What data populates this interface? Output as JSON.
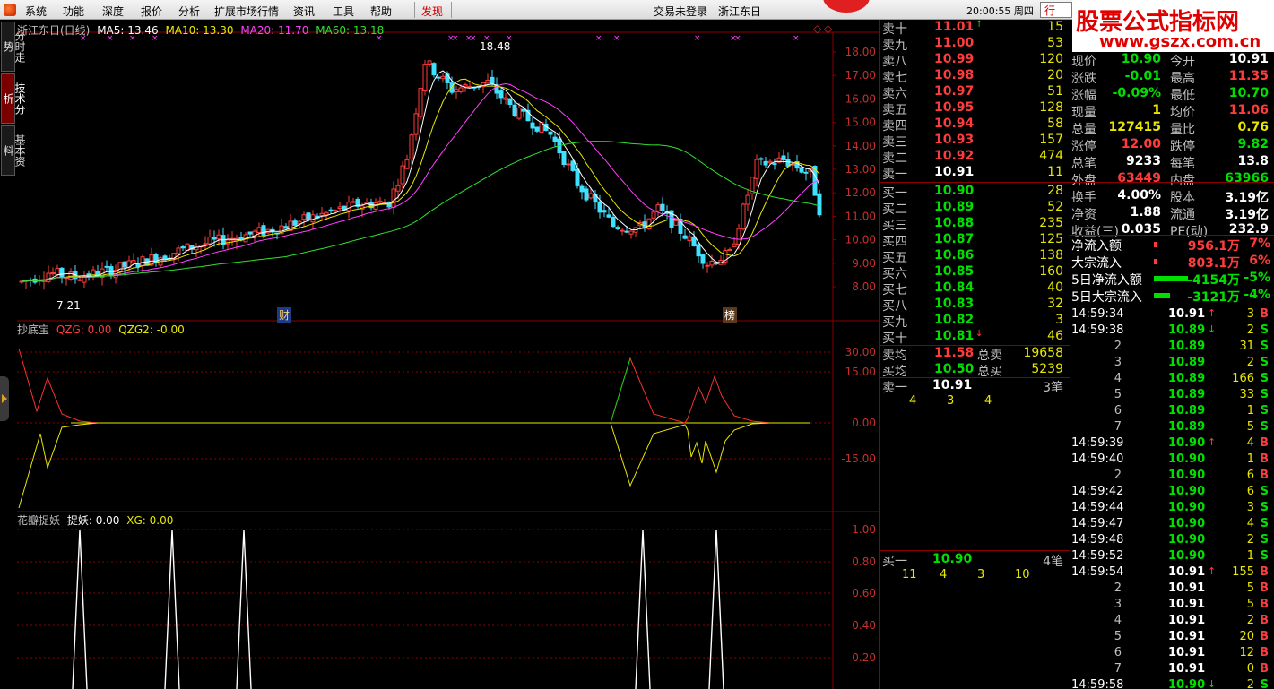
{
  "menubar": {
    "items": [
      "系统",
      "功能",
      "深度",
      "报价",
      "分析",
      "扩展市场行情",
      "资讯",
      "工具",
      "帮助"
    ],
    "highlight": "发现",
    "status": "交易未登录",
    "stock_name": "浙江东日",
    "time": "20:00:55 周四",
    "trade_btn": "行"
  },
  "watermark": {
    "line1": "股票公式指标网",
    "line2": "www.gszx.com.cn"
  },
  "left_tabs": [
    "分时走势",
    "技术分析",
    "基本资料"
  ],
  "chart": {
    "title": "浙江东日(日线)",
    "ma": [
      {
        "label": "MA5: 13.46",
        "color": "#ffffff"
      },
      {
        "label": "MA10: 13.30",
        "color": "#e8e800"
      },
      {
        "label": "MA20: 11.70",
        "color": "#ff40ff"
      },
      {
        "label": "MA60: 13.18",
        "color": "#30e030"
      }
    ],
    "high_label": "18.48",
    "low_label": "7.21",
    "price_ticks": [
      "18.00",
      "17.00",
      "16.00",
      "15.00",
      "14.00",
      "13.00",
      "12.00",
      "11.00",
      "10.00",
      "9.00",
      "8.00"
    ],
    "event_labels": [
      "财",
      "榜"
    ],
    "ind1": {
      "name": "抄底宝",
      "qzg": "QZG: 0.00",
      "qzg2": "QZG2: -0.00",
      "ticks": [
        "30.00",
        "15.00",
        "0.00",
        "-15.00"
      ]
    },
    "ind2": {
      "name": "花瓣捉妖",
      "zy": "捉妖: 0.00",
      "xg": "XG: 0.00",
      "ticks": [
        "1.00",
        "0.80",
        "0.60",
        "0.40",
        "0.20"
      ]
    }
  },
  "order_book": {
    "sells": [
      {
        "label": "卖十",
        "price": "11.01",
        "vol": "15",
        "mark": "↑"
      },
      {
        "label": "卖九",
        "price": "11.00",
        "vol": "53"
      },
      {
        "label": "卖八",
        "price": "10.99",
        "vol": "120"
      },
      {
        "label": "卖七",
        "price": "10.98",
        "vol": "20"
      },
      {
        "label": "卖六",
        "price": "10.97",
        "vol": "51"
      },
      {
        "label": "卖五",
        "price": "10.95",
        "vol": "128"
      },
      {
        "label": "卖四",
        "price": "10.94",
        "vol": "58"
      },
      {
        "label": "卖三",
        "price": "10.93",
        "vol": "157"
      },
      {
        "label": "卖二",
        "price": "10.92",
        "vol": "474"
      },
      {
        "label": "卖一",
        "price": "10.91",
        "vol": "11"
      }
    ],
    "buys": [
      {
        "label": "买一",
        "price": "10.90",
        "vol": "28"
      },
      {
        "label": "买二",
        "price": "10.89",
        "vol": "52"
      },
      {
        "label": "买三",
        "price": "10.88",
        "vol": "235"
      },
      {
        "label": "买四",
        "price": "10.87",
        "vol": "125"
      },
      {
        "label": "买五",
        "price": "10.86",
        "vol": "138"
      },
      {
        "label": "买六",
        "price": "10.85",
        "vol": "160"
      },
      {
        "label": "买七",
        "price": "10.84",
        "vol": "40"
      },
      {
        "label": "买八",
        "price": "10.83",
        "vol": "32"
      },
      {
        "label": "买九",
        "price": "10.82",
        "vol": "3"
      },
      {
        "label": "买十",
        "price": "10.81",
        "vol": "46",
        "mark": "↓"
      }
    ],
    "avg": [
      {
        "label": "卖均",
        "price": "11.58",
        "l2": "总卖",
        "v": "19658"
      },
      {
        "label": "买均",
        "price": "10.50",
        "l2": "总买",
        "v": "5239"
      }
    ],
    "sell_queue": {
      "label": "卖一",
      "price": "10.91",
      "count": "3笔",
      "vols": [
        "4",
        "3",
        "4"
      ]
    },
    "buy_queue": {
      "label": "买一",
      "price": "10.90",
      "count": "4笔",
      "vols": [
        "11",
        "4",
        "3",
        "10"
      ]
    }
  },
  "stats": {
    "rows": [
      {
        "a": "现价",
        "b": "10.90",
        "c": "今开",
        "d": "10.91",
        "bc": "green",
        "dc": "white"
      },
      {
        "a": "涨跌",
        "b": "-0.01",
        "c": "最高",
        "d": "11.35",
        "bc": "green",
        "dc": "red"
      },
      {
        "a": "涨幅",
        "b": "-0.09%",
        "c": "最低",
        "d": "10.70",
        "bc": "green",
        "dc": "green"
      },
      {
        "a": "现量",
        "b": "1",
        "c": "均价",
        "d": "11.06",
        "bc": "yellow",
        "dc": "red"
      },
      {
        "a": "总量",
        "b": "127415",
        "c": "量比",
        "d": "0.76",
        "bc": "yellow",
        "dc": "yellow"
      },
      {
        "a": "涨停",
        "b": "12.00",
        "c": "跌停",
        "d": "9.82",
        "bc": "red",
        "dc": "green"
      },
      {
        "a": "总笔",
        "b": "9233",
        "c": "每笔",
        "d": "13.8",
        "bc": "white",
        "dc": "white"
      },
      {
        "a": "外盘",
        "b": "63449",
        "c": "内盘",
        "d": "63966",
        "bc": "red",
        "dc": "green"
      },
      {
        "a": "换手",
        "b": "4.00%",
        "c": "股本",
        "d": "3.19亿",
        "bc": "white",
        "dc": "white"
      },
      {
        "a": "净资",
        "b": "1.88",
        "c": "流通",
        "d": "3.19亿",
        "bc": "white",
        "dc": "white"
      },
      {
        "a": "收益(三)",
        "b": "0.035",
        "c": "PE(动)",
        "d": "232.9",
        "bc": "white",
        "dc": "white"
      }
    ],
    "flows": [
      {
        "a": "净流入额",
        "v": "956.1万",
        "p": "7%",
        "color": "#ff3c3c",
        "bar": 4
      },
      {
        "a": "大宗流入",
        "v": "803.1万",
        "p": "6%",
        "color": "#ff3c3c",
        "bar": 4
      },
      {
        "a": "5日净流入额",
        "v": "-4154万",
        "p": "-5%",
        "color": "#00e000",
        "bar": 38
      },
      {
        "a": "5日大宗流入",
        "v": "-3121万",
        "p": "-4%",
        "color": "#00e000",
        "bar": 18
      }
    ]
  },
  "ticks": [
    {
      "t": "14:59:34",
      "p": "10.91",
      "a": "↑",
      "v": "3",
      "s": "B"
    },
    {
      "t": "14:59:38",
      "p": "10.89",
      "a": "↓",
      "v": "2",
      "s": "S"
    },
    {
      "t": "2",
      "p": "10.89",
      "v": "31",
      "s": "S"
    },
    {
      "t": "3",
      "p": "10.89",
      "v": "2",
      "s": "S"
    },
    {
      "t": "4",
      "p": "10.89",
      "v": "166",
      "s": "S"
    },
    {
      "t": "5",
      "p": "10.89",
      "v": "33",
      "s": "S"
    },
    {
      "t": "6",
      "p": "10.89",
      "v": "1",
      "s": "S"
    },
    {
      "t": "7",
      "p": "10.89",
      "v": "5",
      "s": "S"
    },
    {
      "t": "14:59:39",
      "p": "10.90",
      "a": "↑",
      "v": "4",
      "s": "B"
    },
    {
      "t": "14:59:40",
      "p": "10.90",
      "v": "1",
      "s": "B"
    },
    {
      "t": "2",
      "p": "10.90",
      "v": "6",
      "s": "B"
    },
    {
      "t": "14:59:42",
      "p": "10.90",
      "v": "6",
      "s": "S"
    },
    {
      "t": "14:59:44",
      "p": "10.90",
      "v": "3",
      "s": "S"
    },
    {
      "t": "14:59:47",
      "p": "10.90",
      "v": "4",
      "s": "S"
    },
    {
      "t": "14:59:48",
      "p": "10.90",
      "v": "2",
      "s": "S"
    },
    {
      "t": "14:59:52",
      "p": "10.90",
      "v": "1",
      "s": "S"
    },
    {
      "t": "14:59:54",
      "p": "10.91",
      "a": "↑",
      "v": "155",
      "s": "B"
    },
    {
      "t": "2",
      "p": "10.91",
      "v": "5",
      "s": "B"
    },
    {
      "t": "3",
      "p": "10.91",
      "v": "5",
      "s": "B"
    },
    {
      "t": "4",
      "p": "10.91",
      "v": "2",
      "s": "B"
    },
    {
      "t": "5",
      "p": "10.91",
      "v": "20",
      "s": "B"
    },
    {
      "t": "6",
      "p": "10.91",
      "v": "12",
      "s": "B"
    },
    {
      "t": "7",
      "p": "10.91",
      "v": "0",
      "s": "B"
    },
    {
      "t": "14:59:58",
      "p": "10.90",
      "a": "↓",
      "v": "2",
      "s": "S"
    }
  ]
}
